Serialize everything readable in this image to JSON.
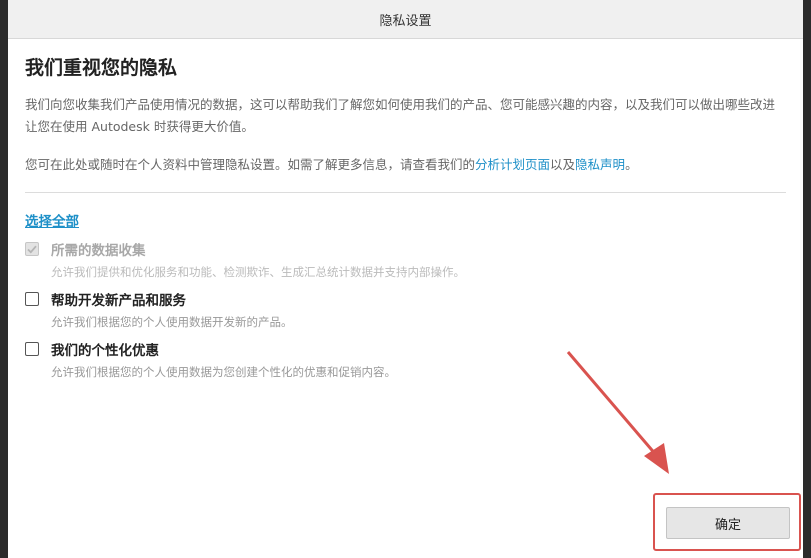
{
  "window": {
    "title": "隐私设置"
  },
  "main": {
    "heading": "我们重视您的隐私",
    "paragraph1": "我们向您收集我们产品使用情况的数据，这可以帮助我们了解您如何使用我们的产品、您可能感兴趣的内容，以及我们可以做出哪些改进让您在使用 Autodesk 时获得更大价值。",
    "paragraph2_prefix": "您可在此处或随时在个人资料中管理隐私设置。如需了解更多信息，请查看我们的",
    "link_analytics": "分析计划页面",
    "paragraph2_middle": "以及",
    "link_privacy": "隐私声明",
    "paragraph2_suffix": "。",
    "select_all": "选择全部"
  },
  "options": [
    {
      "title": "所需的数据收集",
      "description": "允许我们提供和优化服务和功能、检测欺诈、生成汇总统计数据并支持内部操作。",
      "checked": true,
      "disabled": true
    },
    {
      "title": "帮助开发新产品和服务",
      "description": "允许我们根据您的个人使用数据开发新的产品。",
      "checked": false,
      "disabled": false
    },
    {
      "title": "我们的个性化优惠",
      "description": "允许我们根据您的个人使用数据为您创建个性化的优惠和促销内容。",
      "checked": false,
      "disabled": false
    }
  ],
  "footer": {
    "ok_label": "确定"
  },
  "colors": {
    "link": "#1e90c8",
    "annotation": "#d9534f"
  }
}
